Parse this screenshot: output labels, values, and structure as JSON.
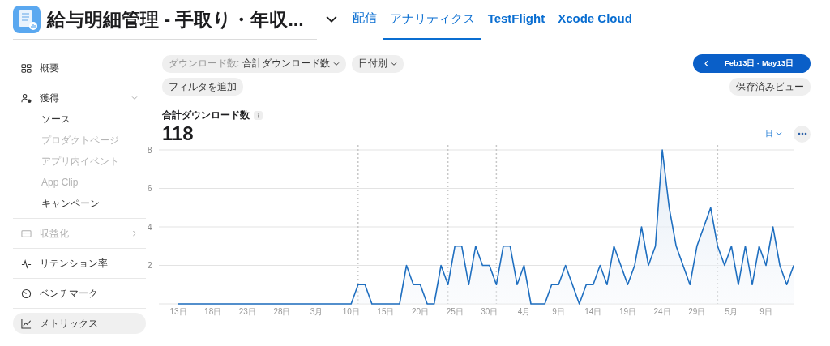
{
  "app": {
    "title": "給与明細管理 - 手取り・年収..."
  },
  "tabs": [
    {
      "label": "配信",
      "selected": false
    },
    {
      "label": "アナリティクス",
      "selected": true
    },
    {
      "label": "TestFlight",
      "selected": false
    },
    {
      "label": "Xcode Cloud",
      "selected": false
    }
  ],
  "sidebar": {
    "items": [
      {
        "kind": "grid",
        "label": "概要",
        "selected": false,
        "disabled": false
      },
      {
        "kind": "person",
        "label": "獲得",
        "selected": false,
        "disabled": false,
        "expanded": true,
        "children": [
          {
            "label": "ソース",
            "disabled": false
          },
          {
            "label": "プロダクトページ",
            "disabled": true
          },
          {
            "label": "アプリ内イベント",
            "disabled": true
          },
          {
            "label": "App Clip",
            "disabled": true
          },
          {
            "label": "キャンペーン",
            "disabled": false
          }
        ]
      },
      {
        "kind": "card",
        "label": "収益化",
        "selected": false,
        "disabled": true,
        "expanded": false
      },
      {
        "kind": "pulse",
        "label": "リテンション率",
        "selected": false,
        "disabled": false
      },
      {
        "kind": "gauge",
        "label": "ベンチマーク",
        "selected": false,
        "disabled": false
      },
      {
        "kind": "chart",
        "label": "メトリックス",
        "selected": true,
        "disabled": false
      }
    ]
  },
  "filters": [
    {
      "prefix": "ダウンロード数:",
      "label": "合計ダウンロード数"
    },
    {
      "label": "日付別"
    }
  ],
  "add_filter": "フィルタを追加",
  "date_range": "Feb13日 - May13日",
  "saved_views": "保存済みビュー",
  "metric": {
    "title": "合計ダウンロード数",
    "value": "118",
    "interval": "日"
  },
  "chart_data": {
    "type": "area",
    "grid": true,
    "ylim": [
      0,
      8
    ],
    "yticks": [
      2,
      4,
      6,
      8
    ],
    "categories": [
      "13日",
      null,
      null,
      null,
      null,
      "18日",
      null,
      null,
      null,
      null,
      "23日",
      null,
      null,
      null,
      null,
      "28日",
      null,
      null,
      null,
      null,
      "3月",
      null,
      null,
      null,
      null,
      "10日",
      null,
      null,
      null,
      null,
      "15日",
      null,
      null,
      null,
      null,
      "20日",
      null,
      null,
      null,
      null,
      "25日",
      null,
      null,
      null,
      null,
      "30日",
      null,
      null,
      null,
      null,
      "4月",
      null,
      null,
      null,
      null,
      "9日",
      null,
      null,
      null,
      null,
      "14日",
      null,
      null,
      null,
      null,
      "19日",
      null,
      null,
      null,
      null,
      "24日",
      null,
      null,
      null,
      null,
      "29日",
      null,
      null,
      null,
      null,
      "5月",
      null,
      null,
      null,
      null,
      "9日",
      null,
      null,
      null,
      null
    ],
    "values": [
      0,
      0,
      0,
      0,
      0,
      0,
      0,
      0,
      0,
      0,
      0,
      0,
      0,
      0,
      0,
      0,
      0,
      0,
      0,
      0,
      0,
      0,
      0,
      0,
      0,
      0,
      1,
      1,
      0,
      0,
      0,
      0,
      0,
      2,
      1,
      1,
      0,
      0,
      2,
      1,
      3,
      3,
      1,
      3,
      2,
      2,
      1,
      3,
      3,
      1,
      2,
      0,
      0,
      0,
      1,
      1,
      2,
      1,
      0,
      1,
      1,
      2,
      1,
      3,
      2,
      1,
      2,
      4,
      2,
      3,
      8,
      5,
      3,
      2,
      1,
      3,
      4,
      5,
      3,
      2,
      3,
      1,
      3,
      1,
      3,
      2,
      4,
      2,
      1,
      2
    ]
  }
}
